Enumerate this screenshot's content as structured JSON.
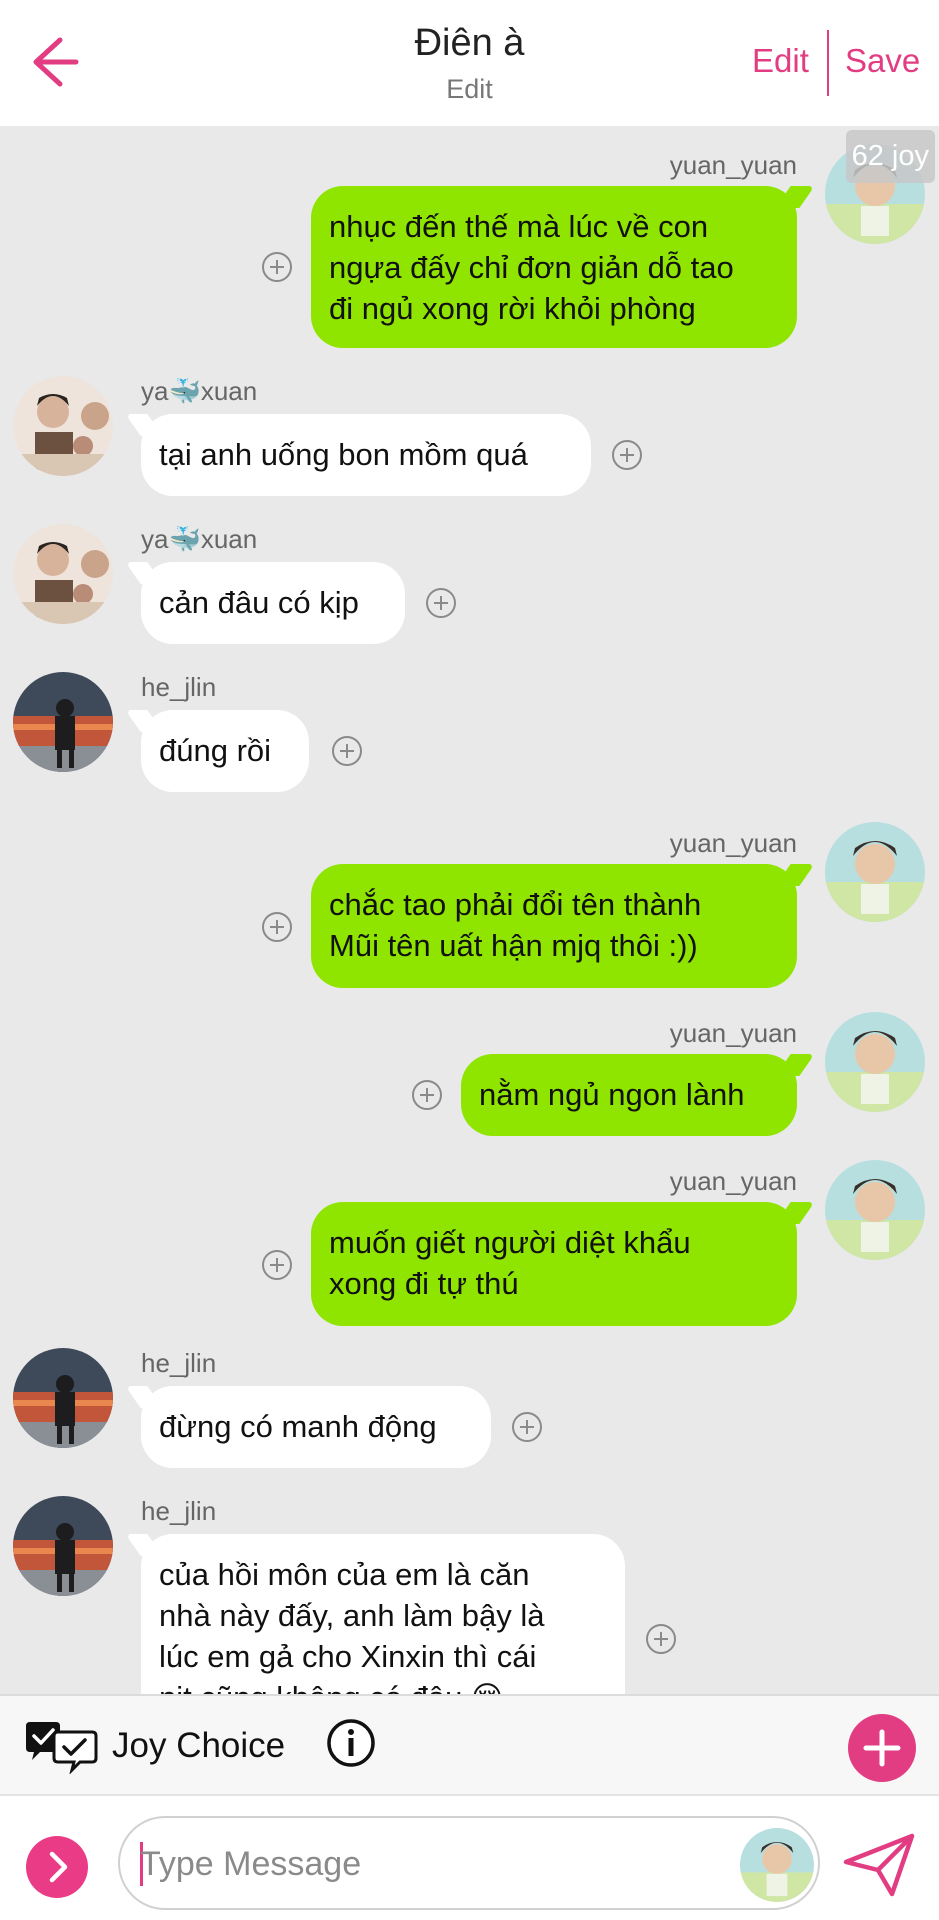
{
  "header": {
    "title": "Điên à",
    "subtitle": "Edit",
    "edit_label": "Edit",
    "save_label": "Save"
  },
  "joy_badge": "62 joy",
  "messages": [
    {
      "sender": "yuan_yuan",
      "side": "right",
      "text": "nhục đến thế mà lúc về con\nngựa đấy chỉ đơn giản dỗ tao\nđi ngủ xong rời khỏi phòng"
    },
    {
      "sender": "ya🐳xuan",
      "side": "left",
      "text": "tại anh uống bon mồm quá"
    },
    {
      "sender": "ya🐳xuan",
      "side": "left",
      "text": "cản đâu có kịp"
    },
    {
      "sender": "he_jlin",
      "side": "left",
      "text": "đúng rồi"
    },
    {
      "sender": "yuan_yuan",
      "side": "right",
      "text": "chắc tao phải đổi tên thành\nMũi tên uất hận mjq thôi :))"
    },
    {
      "sender": "yuan_yuan",
      "side": "right",
      "text": "nằm ngủ ngon lành"
    },
    {
      "sender": "yuan_yuan",
      "side": "right",
      "text": "muốn giết người diệt khẩu\nxong đi tự thú"
    },
    {
      "sender": "he_jlin",
      "side": "left",
      "text": "đừng có manh động"
    },
    {
      "sender": "he_jlin",
      "side": "left",
      "text": "của hồi môn của em là căn\nnhà này đấy, anh làm bậy là\nlúc em gả cho Xinxin thì cái\nnịt cũng không có đâu 😔"
    }
  ],
  "joy_bar": {
    "label": "Joy Choice"
  },
  "composer": {
    "placeholder": "Type Message"
  },
  "colors": {
    "accent": "#e23d82",
    "outgoing_bubble": "#8fe400",
    "incoming_bubble": "#ffffff",
    "background": "#e9e9e9"
  },
  "icons": [
    "back-arrow-icon",
    "add-reaction-icon",
    "joy-choice-icon",
    "info-icon",
    "plus-icon",
    "chevron-right-icon",
    "send-icon"
  ]
}
